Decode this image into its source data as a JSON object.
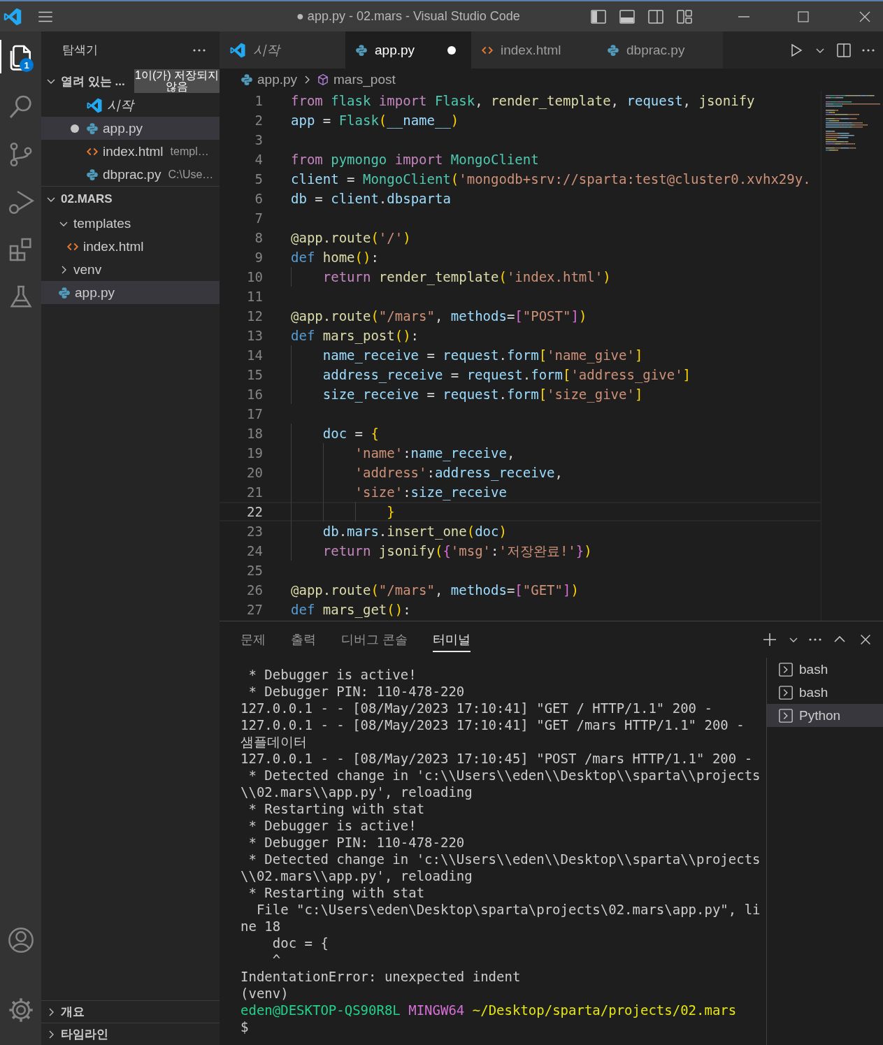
{
  "window": {
    "title": "● app.py - 02.mars - Visual Studio Code"
  },
  "activity_bar": {
    "explorer_badge": "1"
  },
  "sidebar": {
    "title": "탐색기",
    "open_editors": {
      "title": "열려 있는 ...",
      "expanded": true,
      "unsaved_badge": "1이(가) 저장되지 않음",
      "items": [
        {
          "label": "시작",
          "kind": "vscode",
          "preview": true,
          "dirty": false,
          "selected": false
        },
        {
          "label": "app.py",
          "kind": "python",
          "preview": false,
          "dirty": true,
          "selected": true
        },
        {
          "label": "index.html",
          "description": "templ…",
          "kind": "html",
          "preview": false,
          "dirty": false,
          "selected": false
        },
        {
          "label": "dbprac.py",
          "description": "C:\\Use…",
          "kind": "python",
          "preview": false,
          "dirty": false,
          "selected": false
        }
      ]
    },
    "folder": {
      "title": "02.MARS",
      "expanded": true,
      "items": [
        {
          "label": "templates",
          "kind": "folder",
          "expanded": true,
          "selected": false,
          "children": [
            {
              "label": "index.html",
              "kind": "html",
              "selected": false
            }
          ]
        },
        {
          "label": "venv",
          "kind": "folder",
          "expanded": false,
          "selected": false
        },
        {
          "label": "app.py",
          "kind": "python",
          "selected": true
        }
      ]
    },
    "bottom_sections": [
      {
        "title": "개요",
        "expanded": false
      },
      {
        "title": "타임라인",
        "expanded": false
      }
    ]
  },
  "tabs": [
    {
      "label": "시작",
      "kind": "vscode",
      "preview": true,
      "dirty": false,
      "selected": false
    },
    {
      "label": "app.py",
      "kind": "python",
      "preview": false,
      "dirty": true,
      "selected": true
    },
    {
      "label": "index.html",
      "kind": "html",
      "preview": false,
      "dirty": false,
      "selected": false
    },
    {
      "label": "dbprac.py",
      "kind": "python",
      "preview": false,
      "dirty": false,
      "selected": false
    }
  ],
  "breadcrumb": [
    {
      "label": "app.py",
      "kind": "python"
    },
    {
      "label": "mars_post",
      "kind": "symbol"
    }
  ],
  "editor": {
    "lines": [
      {
        "number": "1",
        "current": false,
        "tokens": [
          {
            "kind": "kw",
            "text": "from "
          },
          {
            "kind": "cls",
            "text": "flask "
          },
          {
            "kind": "kw",
            "text": "import "
          },
          {
            "kind": "cls",
            "text": "Flask"
          },
          {
            "kind": "plain",
            "text": ", "
          },
          {
            "kind": "fn",
            "text": "render_template"
          },
          {
            "kind": "plain",
            "text": ", "
          },
          {
            "kind": "var",
            "text": "request"
          },
          {
            "kind": "plain",
            "text": ", "
          },
          {
            "kind": "fn",
            "text": "jsonify"
          }
        ]
      },
      {
        "number": "2",
        "current": false,
        "tokens": [
          {
            "kind": "var",
            "text": "app"
          },
          {
            "kind": "plain",
            "text": " = "
          },
          {
            "kind": "cls",
            "text": "Flask"
          },
          {
            "kind": "b1",
            "text": "("
          },
          {
            "kind": "var",
            "text": "__name__"
          },
          {
            "kind": "b1",
            "text": ")"
          }
        ]
      },
      {
        "number": "3",
        "current": false
      },
      {
        "number": "4",
        "current": false,
        "tokens": [
          {
            "kind": "kw",
            "text": "from "
          },
          {
            "kind": "cls",
            "text": "pymongo "
          },
          {
            "kind": "kw",
            "text": "import "
          },
          {
            "kind": "cls",
            "text": "MongoClient"
          }
        ]
      },
      {
        "number": "5",
        "current": false,
        "tokens": [
          {
            "kind": "var",
            "text": "client"
          },
          {
            "kind": "plain",
            "text": " = "
          },
          {
            "kind": "cls",
            "text": "MongoClient"
          },
          {
            "kind": "b1",
            "text": "("
          },
          {
            "kind": "str",
            "text": "'mongodb+srv://sparta:test@cluster0.xvhx29y."
          }
        ]
      },
      {
        "number": "6",
        "current": false,
        "tokens": [
          {
            "kind": "var",
            "text": "db"
          },
          {
            "kind": "plain",
            "text": " = "
          },
          {
            "kind": "var",
            "text": "client"
          },
          {
            "kind": "plain",
            "text": "."
          },
          {
            "kind": "var",
            "text": "dbsparta"
          }
        ]
      },
      {
        "number": "7",
        "current": false
      },
      {
        "number": "8",
        "current": false,
        "tokens": [
          {
            "kind": "fn",
            "text": "@app.route"
          },
          {
            "kind": "b1",
            "text": "("
          },
          {
            "kind": "str",
            "text": "'/'"
          },
          {
            "kind": "b1",
            "text": ")"
          }
        ]
      },
      {
        "number": "9",
        "current": false,
        "tokens": [
          {
            "kind": "def",
            "text": "def "
          },
          {
            "kind": "fn",
            "text": "home"
          },
          {
            "kind": "b1",
            "text": "()"
          },
          {
            "kind": "plain",
            "text": ":"
          }
        ]
      },
      {
        "number": "10",
        "current": false,
        "tokens": [
          {
            "kind": "kw",
            "text": "    return "
          },
          {
            "kind": "fn",
            "text": "render_template"
          },
          {
            "kind": "b1",
            "text": "("
          },
          {
            "kind": "str",
            "text": "'index.html'"
          },
          {
            "kind": "b1",
            "text": ")"
          }
        ]
      },
      {
        "number": "11",
        "current": false
      },
      {
        "number": "12",
        "current": false,
        "tokens": [
          {
            "kind": "fn",
            "text": "@app.route"
          },
          {
            "kind": "b1",
            "text": "("
          },
          {
            "kind": "str",
            "text": "\"/mars\""
          },
          {
            "kind": "plain",
            "text": ", "
          },
          {
            "kind": "var",
            "text": "methods"
          },
          {
            "kind": "plain",
            "text": "="
          },
          {
            "kind": "b2",
            "text": "["
          },
          {
            "kind": "str",
            "text": "\"POST\""
          },
          {
            "kind": "b2",
            "text": "]"
          },
          {
            "kind": "b1",
            "text": ")"
          }
        ]
      },
      {
        "number": "13",
        "current": false,
        "tokens": [
          {
            "kind": "def",
            "text": "def "
          },
          {
            "kind": "fn",
            "text": "mars_post"
          },
          {
            "kind": "b1",
            "text": "()"
          },
          {
            "kind": "plain",
            "text": ":"
          }
        ]
      },
      {
        "number": "14",
        "current": false,
        "tokens": [
          {
            "kind": "var",
            "text": "    name_receive"
          },
          {
            "kind": "plain",
            "text": " = "
          },
          {
            "kind": "var",
            "text": "request"
          },
          {
            "kind": "plain",
            "text": "."
          },
          {
            "kind": "var",
            "text": "form"
          },
          {
            "kind": "b1",
            "text": "["
          },
          {
            "kind": "str",
            "text": "'name_give'"
          },
          {
            "kind": "b1",
            "text": "]"
          }
        ]
      },
      {
        "number": "15",
        "current": false,
        "tokens": [
          {
            "kind": "var",
            "text": "    address_receive"
          },
          {
            "kind": "plain",
            "text": " = "
          },
          {
            "kind": "var",
            "text": "request"
          },
          {
            "kind": "plain",
            "text": "."
          },
          {
            "kind": "var",
            "text": "form"
          },
          {
            "kind": "b1",
            "text": "["
          },
          {
            "kind": "str",
            "text": "'address_give'"
          },
          {
            "kind": "b1",
            "text": "]"
          }
        ]
      },
      {
        "number": "16",
        "current": false,
        "tokens": [
          {
            "kind": "var",
            "text": "    size_receive"
          },
          {
            "kind": "plain",
            "text": " = "
          },
          {
            "kind": "var",
            "text": "request"
          },
          {
            "kind": "plain",
            "text": "."
          },
          {
            "kind": "var",
            "text": "form"
          },
          {
            "kind": "b1",
            "text": "["
          },
          {
            "kind": "str",
            "text": "'size_give'"
          },
          {
            "kind": "b1",
            "text": "]"
          }
        ]
      },
      {
        "number": "17",
        "current": false
      },
      {
        "number": "18",
        "current": false,
        "tokens": [
          {
            "kind": "var",
            "text": "    doc"
          },
          {
            "kind": "plain",
            "text": " = "
          },
          {
            "kind": "b1",
            "text": "{"
          }
        ]
      },
      {
        "number": "19",
        "current": false,
        "tokens": [
          {
            "kind": "str",
            "text": "        'name'"
          },
          {
            "kind": "plain",
            "text": ":"
          },
          {
            "kind": "var",
            "text": "name_receive"
          },
          {
            "kind": "plain",
            "text": ","
          }
        ]
      },
      {
        "number": "20",
        "current": false,
        "tokens": [
          {
            "kind": "str",
            "text": "        'address'"
          },
          {
            "kind": "plain",
            "text": ":"
          },
          {
            "kind": "var",
            "text": "address_receive"
          },
          {
            "kind": "plain",
            "text": ","
          }
        ]
      },
      {
        "number": "21",
        "current": false,
        "tokens": [
          {
            "kind": "str",
            "text": "        'size'"
          },
          {
            "kind": "plain",
            "text": ":"
          },
          {
            "kind": "var",
            "text": "size_receive"
          }
        ]
      },
      {
        "number": "22",
        "current": true,
        "tokens": [
          {
            "kind": "b1",
            "text": "            }"
          }
        ]
      },
      {
        "number": "23",
        "current": false,
        "tokens": [
          {
            "kind": "var",
            "text": "    db"
          },
          {
            "kind": "plain",
            "text": "."
          },
          {
            "kind": "var",
            "text": "mars"
          },
          {
            "kind": "plain",
            "text": "."
          },
          {
            "kind": "fn",
            "text": "insert_one"
          },
          {
            "kind": "b1",
            "text": "("
          },
          {
            "kind": "var",
            "text": "doc"
          },
          {
            "kind": "b1",
            "text": ")"
          }
        ]
      },
      {
        "number": "24",
        "current": false,
        "tokens": [
          {
            "kind": "kw",
            "text": "    return "
          },
          {
            "kind": "fn",
            "text": "jsonify"
          },
          {
            "kind": "b1",
            "text": "("
          },
          {
            "kind": "b2",
            "text": "{"
          },
          {
            "kind": "str",
            "text": "'msg'"
          },
          {
            "kind": "plain",
            "text": ":"
          },
          {
            "kind": "str",
            "text": "'저장완료!'"
          },
          {
            "kind": "b2",
            "text": "}"
          },
          {
            "kind": "b1",
            "text": ")"
          }
        ]
      },
      {
        "number": "25",
        "current": false
      },
      {
        "number": "26",
        "current": false,
        "tokens": [
          {
            "kind": "fn",
            "text": "@app.route"
          },
          {
            "kind": "b1",
            "text": "("
          },
          {
            "kind": "str",
            "text": "\"/mars\""
          },
          {
            "kind": "plain",
            "text": ", "
          },
          {
            "kind": "var",
            "text": "methods"
          },
          {
            "kind": "plain",
            "text": "="
          },
          {
            "kind": "b2",
            "text": "["
          },
          {
            "kind": "str",
            "text": "\"GET\""
          },
          {
            "kind": "b2",
            "text": "]"
          },
          {
            "kind": "b1",
            "text": ")"
          }
        ]
      },
      {
        "number": "27",
        "current": false,
        "tokens": [
          {
            "kind": "def",
            "text": "def "
          },
          {
            "kind": "fn",
            "text": "mars_get"
          },
          {
            "kind": "b1",
            "text": "()"
          },
          {
            "kind": "plain",
            "text": ":"
          }
        ]
      }
    ]
  },
  "panel": {
    "tabs": [
      {
        "label": "문제",
        "selected": false
      },
      {
        "label": "출력",
        "selected": false
      },
      {
        "label": "디버그 콘솔",
        "selected": false
      },
      {
        "label": "터미널",
        "selected": true
      }
    ],
    "terminal_lines": [
      {
        "kind": "output",
        "text": " * Debugger is active!"
      },
      {
        "kind": "output",
        "text": " * Debugger PIN: 110-478-220"
      },
      {
        "kind": "output",
        "text": "127.0.0.1 - - [08/May/2023 17:10:41] \"GET / HTTP/1.1\" 200 -"
      },
      {
        "kind": "output",
        "text": "127.0.0.1 - - [08/May/2023 17:10:41] \"GET /mars HTTP/1.1\" 200 -"
      },
      {
        "kind": "output",
        "text": "샘플데이터"
      },
      {
        "kind": "output",
        "text": "127.0.0.1 - - [08/May/2023 17:10:45] \"POST /mars HTTP/1.1\" 200 -"
      },
      {
        "kind": "output",
        "text": " * Detected change in 'c:\\\\Users\\\\eden\\\\Desktop\\\\sparta\\\\projects"
      },
      {
        "kind": "output",
        "text": "\\\\02.mars\\\\app.py', reloading"
      },
      {
        "kind": "output",
        "text": " * Restarting with stat"
      },
      {
        "kind": "output",
        "text": " * Debugger is active!"
      },
      {
        "kind": "output",
        "text": " * Debugger PIN: 110-478-220"
      },
      {
        "kind": "output",
        "text": " * Detected change in 'c:\\\\Users\\\\eden\\\\Desktop\\\\sparta\\\\projects"
      },
      {
        "kind": "output",
        "text": "\\\\02.mars\\\\app.py', reloading"
      },
      {
        "kind": "output",
        "text": " * Restarting with stat"
      },
      {
        "kind": "output",
        "text": "  File \"c:\\Users\\eden\\Desktop\\sparta\\projects\\02.mars\\app.py\", li"
      },
      {
        "kind": "output",
        "text": "ne 18"
      },
      {
        "kind": "output",
        "text": "    doc = {"
      },
      {
        "kind": "output",
        "text": "    ^"
      },
      {
        "kind": "output",
        "text": "IndentationError: unexpected indent"
      },
      {
        "kind": "output",
        "text": "(venv)"
      },
      {
        "kind": "prompt",
        "user": "eden@DESKTOP-QS90R8L",
        "shell": "MINGW64",
        "path": "~/Desktop/sparta/projects/02.mars"
      },
      {
        "kind": "output",
        "text": "$"
      }
    ],
    "terminals": [
      {
        "label": "bash",
        "selected": false
      },
      {
        "label": "bash",
        "selected": false
      },
      {
        "label": "Python",
        "selected": true
      }
    ]
  }
}
